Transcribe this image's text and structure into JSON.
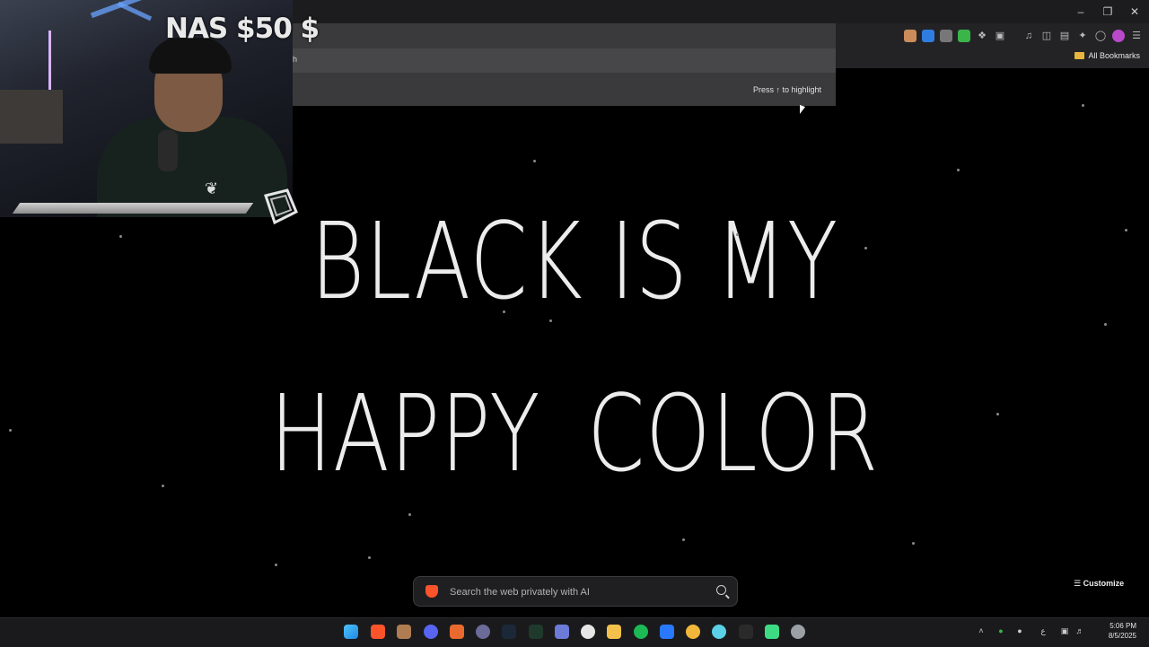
{
  "overlay": {
    "stream_title": "NAS $50 $"
  },
  "browser": {
    "omnibox_text": "h",
    "omnibox_hint": "Press ↑ to highlight",
    "bookmarks_label": "All Bookmarks"
  },
  "page": {
    "headline_line1": "BLACK IS MY",
    "headline_line2": "HAPPY  COLOR",
    "search_placeholder": "Search the web privately with AI",
    "customize_label": "Customize"
  },
  "taskbar": {
    "time": "5:06 PM",
    "date": "8/5/2025",
    "language": "ع"
  },
  "colors": {
    "brave_orange": "#fb542b",
    "page_background": "#000000"
  }
}
